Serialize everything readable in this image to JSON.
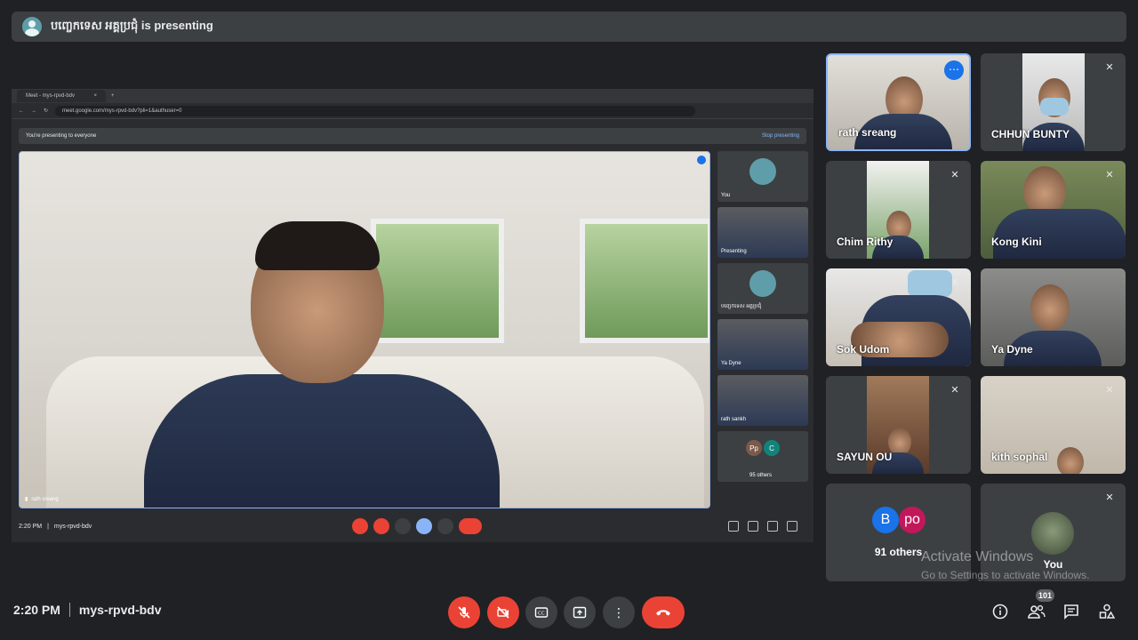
{
  "banner": {
    "text": "បញ្ចេកទេស អគ្គប្រជុំ is presenting"
  },
  "shared_screen": {
    "tab_title": "Meet - mys-rpvd-bdv",
    "url": "meet.google.com/mys-rpvd-bdv?pli=1&authuser=0",
    "presenting_text": "You're presenting to everyone",
    "stop_label": "Stop presenting",
    "main_speaker": "rath sreang",
    "tiles": [
      {
        "label": "You"
      },
      {
        "label": "Presenting"
      },
      {
        "label": "បញ្ចេកទេស អគ្គប្រជុំ"
      },
      {
        "label": "Ya Dyne"
      },
      {
        "label": "rath sankh"
      },
      {
        "initials": [
          "Pp",
          "C"
        ],
        "label": "95 others"
      }
    ],
    "time": "2:20 PM",
    "meeting_code": "mys-rpvd-bdv"
  },
  "participants": [
    {
      "name": "rath sreang"
    },
    {
      "name": "CHHUN BUNTY"
    },
    {
      "name": "Chim Rithy"
    },
    {
      "name": "Kong Kini"
    },
    {
      "name": "Sok Udom"
    },
    {
      "name": "Ya Dyne"
    },
    {
      "name": "SAYUN OU"
    },
    {
      "name": "kith sophal"
    },
    {
      "initials": [
        "B",
        "po"
      ],
      "name": "91 others"
    },
    {
      "name": "You"
    }
  ],
  "watermark": {
    "title": "Activate Windows",
    "subtitle": "Go to Settings to activate Windows."
  },
  "footer": {
    "time": "2:20 PM",
    "meeting_code": "mys-rpvd-bdv",
    "people_count": "101"
  },
  "colors": {
    "background": "#202124",
    "tile": "#3c4043",
    "danger": "#ea4335",
    "accent": "#1a73e8",
    "active_border": "#8ab4f8"
  },
  "icons": {
    "controls": [
      "mic-off-icon",
      "camera-off-icon",
      "captions-icon",
      "present-icon",
      "more-options-icon",
      "hang-up-icon"
    ],
    "right": [
      "info-icon",
      "people-icon",
      "chat-icon",
      "activities-icon"
    ]
  }
}
